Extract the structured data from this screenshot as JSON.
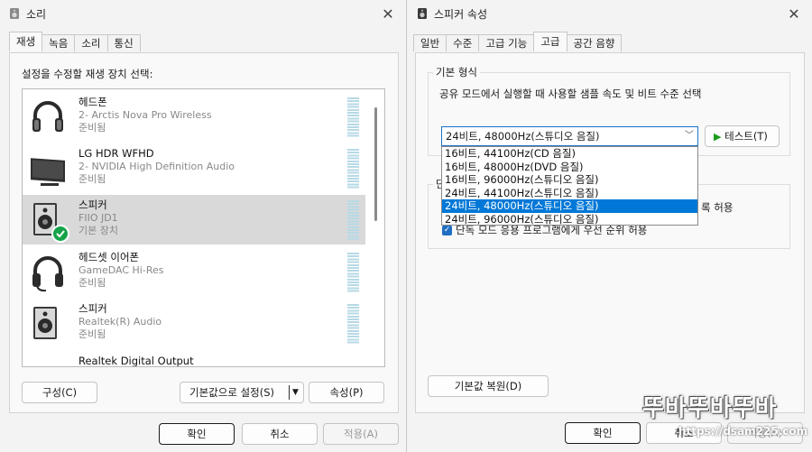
{
  "sound": {
    "title": "소리",
    "tabs": [
      "재생",
      "녹음",
      "소리",
      "통신"
    ],
    "instruction": "설정을 수정할 재생 장치 선택:",
    "devices": [
      {
        "name": "헤드폰",
        "line2": "2- Arctis Nova Pro Wireless",
        "line3": "준비됨",
        "icon": "headphones-icon"
      },
      {
        "name": "LG HDR WFHD",
        "line2": "2- NVIDIA High Definition Audio",
        "line3": "준비됨",
        "icon": "monitor-icon"
      },
      {
        "name": "스피커",
        "line2": "FIIO JD1",
        "line3": "기본 장치",
        "icon": "speaker-icon"
      },
      {
        "name": "헤드셋 이어폰",
        "line2": "GameDAC Hi-Res",
        "line3": "준비됨",
        "icon": "headset-icon"
      },
      {
        "name": "스피커",
        "line2": "Realtek(R) Audio",
        "line3": "준비됨",
        "icon": "speaker-icon"
      },
      {
        "name": "Realtek Digital Output",
        "line2": "",
        "line3": "",
        "icon": "digital-output-icon"
      }
    ],
    "configure_label": "구성(C)",
    "set_default_label": "기본값으로 설정(S)",
    "properties_label": "속성(P)",
    "ok_label": "확인",
    "cancel_label": "취소",
    "apply_label": "적용(A)"
  },
  "props": {
    "title": "스피커 속성",
    "tabs": [
      "일반",
      "수준",
      "고급 기능",
      "고급",
      "공간 음향"
    ],
    "format_group_title": "기본 형식",
    "format_description": "공유 모드에서 실행할 때 사용할 샘플 속도 및 비트 수준 선택",
    "format_selected": "24비트, 48000Hz(스튜디오 음질)",
    "format_options": [
      "16비트, 44100Hz(CD 음질)",
      "16비트, 48000Hz(DVD 음질)",
      "16비트, 96000Hz(스튜디오 음질)",
      "24비트, 44100Hz(스튜디오 음질)",
      "24비트, 48000Hz(스튜디오 음질)",
      "24비트, 96000Hz(스튜디오 음질)"
    ],
    "test_label": "테스트(T)",
    "exclusive_group_title": "단",
    "exclusive_option1_tail": "록 허용",
    "exclusive_option2": "단독 모드 응용 프로그램에게 우선 순위 허용",
    "restore_defaults_label": "기본값 복원(D)",
    "ok_label": "확인",
    "cancel_label": "취소",
    "apply_label": "적용(A)"
  },
  "watermark": {
    "line1": "뚜바뚜바뚜바",
    "line2": "https://dsam225.com"
  },
  "colors": {
    "accent": "#0078d7",
    "check_green": "#16a34a",
    "test_green": "#1a9c1a"
  }
}
